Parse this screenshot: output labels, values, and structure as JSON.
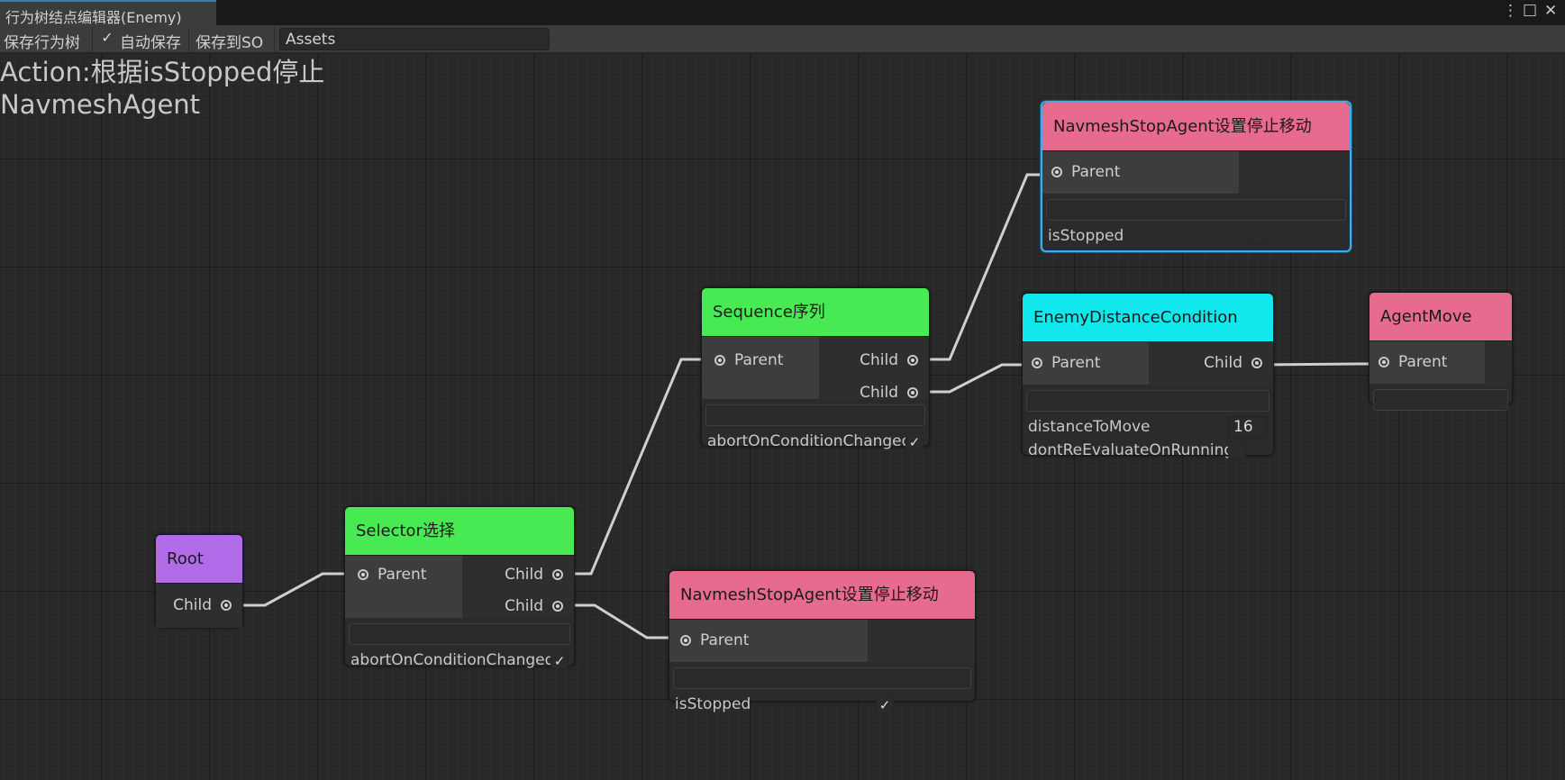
{
  "window": {
    "title": "行为树结点编辑器(Enemy)",
    "menu_icon": "⋮",
    "maximize_icon": "□",
    "close_icon": "✕"
  },
  "toolbar": {
    "save_tree": "保存行为树",
    "auto_save_label": "自动保存",
    "auto_save_checked": "✓",
    "save_to_so": "保存到SO",
    "path_value": "Assets"
  },
  "description": "Action:根据isStopped停止NavmeshAgent",
  "nodes": {
    "root": {
      "title": "Root",
      "color": "#b16ae8",
      "out_ports": [
        "Child"
      ]
    },
    "selector": {
      "title": "Selector选择",
      "color": "#48ea54",
      "in_port": "Parent",
      "out_ports": [
        "Child",
        "Child"
      ],
      "fields": [
        {
          "label": "abortOnConditionChanged",
          "check": "✓"
        }
      ]
    },
    "sequence": {
      "title": "Sequence序列",
      "color": "#48ea54",
      "in_port": "Parent",
      "out_ports": [
        "Child",
        "Child"
      ],
      "fields": [
        {
          "label": "abortOnConditionChanged",
          "check": "✓"
        }
      ]
    },
    "stop_top": {
      "title": "NavmeshStopAgent设置停止移动",
      "color": "#e76b8f",
      "in_port": "Parent",
      "fields": [
        {
          "label": "isStopped",
          "check": ""
        }
      ]
    },
    "distance": {
      "title": "EnemyDistanceCondition",
      "color": "#10e8ee",
      "in_port": "Parent",
      "out_ports": [
        "Child"
      ],
      "fields": [
        {
          "label": "distanceToMove",
          "value": "16"
        },
        {
          "label": "dontReEvaluateOnRunning",
          "check": ""
        }
      ]
    },
    "agent_move": {
      "title": "AgentMove",
      "color": "#e76b8f",
      "in_port": "Parent"
    },
    "stop_bottom": {
      "title": "NavmeshStopAgent设置停止移动",
      "color": "#e76b8f",
      "in_port": "Parent",
      "fields": [
        {
          "label": "isStopped",
          "check": "✓"
        }
      ]
    }
  },
  "colors": {
    "edge": "#cfcfcf",
    "selection": "#44a9e6",
    "canvas": "#282828"
  }
}
